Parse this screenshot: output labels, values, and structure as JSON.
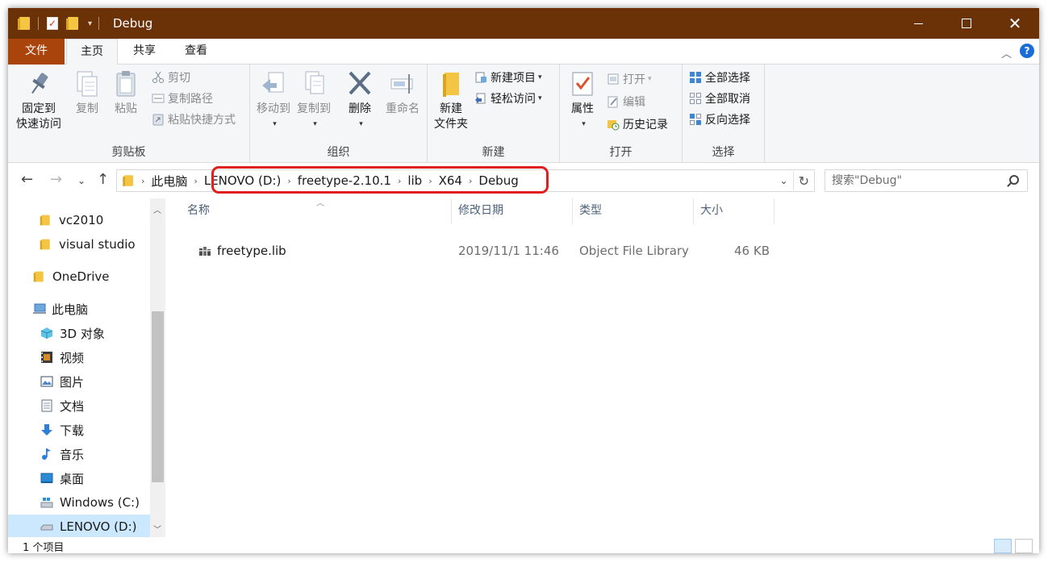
{
  "window": {
    "title": "Debug"
  },
  "tabs": {
    "file": "文件",
    "home": "主页",
    "share": "共享",
    "view": "查看"
  },
  "ribbon": {
    "clipboard": {
      "label": "剪贴板",
      "pin_line1": "固定到",
      "pin_line2": "快速访问",
      "copy": "复制",
      "paste": "粘贴",
      "cut": "剪切",
      "copy_path": "复制路径",
      "paste_shortcut": "粘贴快捷方式"
    },
    "organize": {
      "label": "组织",
      "move_to": "移动到",
      "copy_to": "复制到",
      "delete": "删除",
      "rename": "重命名"
    },
    "new": {
      "label": "新建",
      "new_folder_line1": "新建",
      "new_folder_line2": "文件夹",
      "new_item": "新建项目",
      "easy_access": "轻松访问"
    },
    "open": {
      "label": "打开",
      "properties": "属性",
      "open": "打开",
      "edit": "编辑",
      "history": "历史记录"
    },
    "select": {
      "label": "选择",
      "select_all": "全部选择",
      "select_none": "全部取消",
      "invert": "反向选择"
    }
  },
  "address": {
    "root": "此电脑",
    "crumbs": [
      "LENOVO (D:)",
      "freetype-2.10.1",
      "lib",
      "X64",
      "Debug"
    ]
  },
  "search": {
    "placeholder": "搜索\"Debug\""
  },
  "nav": {
    "items": [
      "vc2010",
      "visual studio",
      "OneDrive",
      "此电脑",
      "3D 对象",
      "视频",
      "图片",
      "文档",
      "下载",
      "音乐",
      "桌面",
      "Windows (C:)",
      "LENOVO (D:)"
    ]
  },
  "columns": {
    "name": "名称",
    "modified": "修改日期",
    "type": "类型",
    "size": "大小"
  },
  "files": [
    {
      "name": "freetype.lib",
      "modified": "2019/11/1 11:46",
      "type": "Object File Library",
      "size": "46 KB"
    }
  ],
  "status": {
    "count": "1 个项目"
  },
  "colors": {
    "titlebar": "#6b3208",
    "file_tab": "#a9440c",
    "highlight": "#e02020",
    "selection": "#cce8ff"
  }
}
